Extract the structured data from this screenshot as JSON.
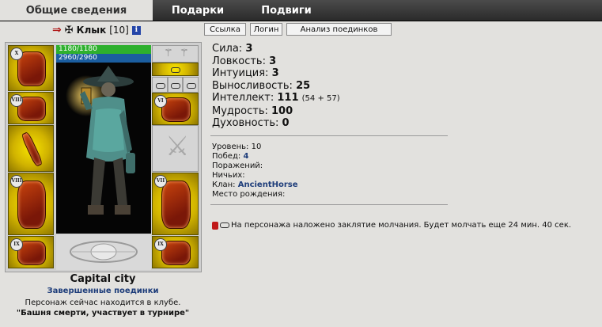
{
  "tabs": {
    "general": "Общие сведения",
    "gifts": "Подарки",
    "feats": "Подвиги"
  },
  "character": {
    "nick": "Клык",
    "level_badge": "[10]",
    "info_icon": "i",
    "hp": "1180/1180",
    "mana": "2960/2960"
  },
  "buttons": {
    "link": "Ссылка",
    "login": "Логин",
    "analysis": "Анализ поединков"
  },
  "stats": {
    "str_label": "Сила:",
    "str": "3",
    "agi_label": "Ловкость:",
    "agi": "3",
    "int_label": "Интуиция:",
    "int": "3",
    "end_label": "Выносливость:",
    "end": "25",
    "intel_label": "Интеллект:",
    "intel": "111",
    "intel_bonus": "(54 + 57)",
    "wis_label": "Мудрость:",
    "wis": "100",
    "spir_label": "Духовность:",
    "spir": "0"
  },
  "info": {
    "level_label": "Уровень:",
    "level": "10",
    "wins_label": "Побед:",
    "wins": "4",
    "losses_label": "Поражений:",
    "draws_label": "Ничьих:",
    "clan_label": "Клан:",
    "clan": "AncientHorse",
    "birthplace_label": "Место рождения:"
  },
  "silence": "На персонажа наложено заклятие молчания. Будет молчать еще 24 мин. 40 сек.",
  "location": {
    "city": "Capital city",
    "battles_link": "Завершенные поединки",
    "club_line1": "Персонаж сейчас находится в клубе.",
    "club_line2": "\"Башня смерти, участвует в турнире\""
  },
  "slots": {
    "roman_helmet": "X",
    "roman_bracers": "VIII",
    "roman_armor": "VIII",
    "roman_belt": "IX",
    "roman_gloves": "VI",
    "roman_pants": "VII",
    "roman_boots": "IX"
  },
  "colors": {
    "hp_bar": "#2eb02e",
    "mana_bar": "#1b5ea0",
    "link_blue": "#1e3d7a",
    "slot_gold": "#e3c800",
    "tab_bar": "#3a3a3a"
  }
}
